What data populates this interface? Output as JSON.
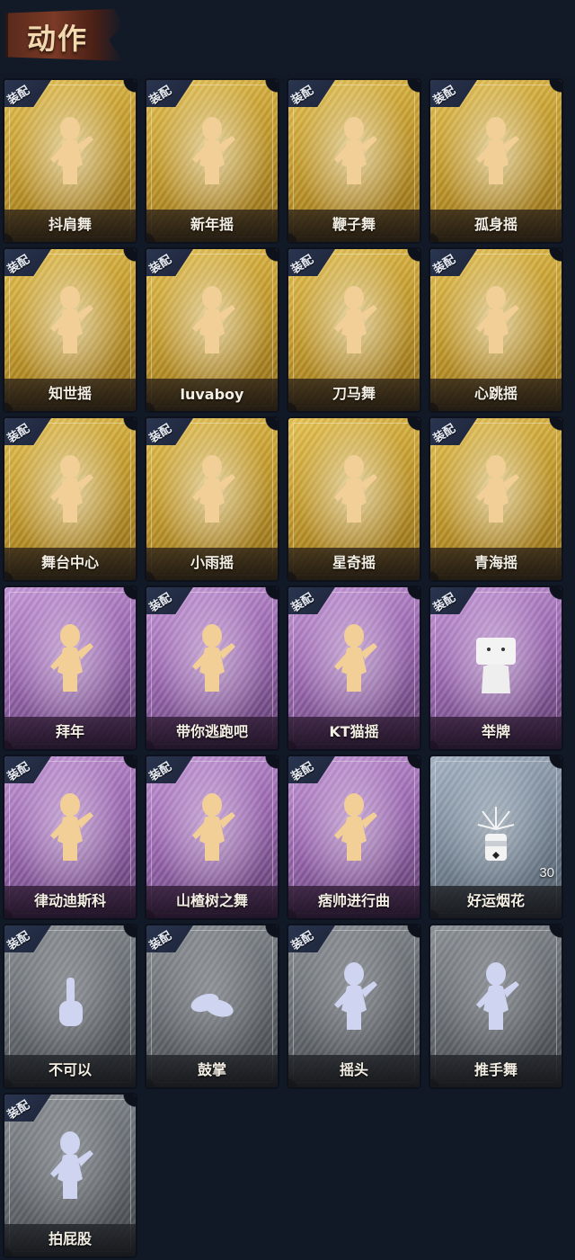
{
  "header": {
    "title": "动作"
  },
  "equip_label": "装配",
  "colors": {
    "gold": "#c39a2b",
    "purple": "#9a67b0",
    "blue": "#7c8b9b",
    "grey": "#6a6f75",
    "background": "#111826"
  },
  "cards": [
    {
      "name": "抖肩舞",
      "rarity": "gold",
      "equipped": true,
      "icon": "dancer-icon"
    },
    {
      "name": "新年摇",
      "rarity": "gold",
      "equipped": true,
      "icon": "dancer-icon"
    },
    {
      "name": "鞭子舞",
      "rarity": "gold",
      "equipped": true,
      "icon": "dancer-icon"
    },
    {
      "name": "孤身摇",
      "rarity": "gold",
      "equipped": true,
      "icon": "dancer-icon"
    },
    {
      "name": "知世摇",
      "rarity": "gold",
      "equipped": true,
      "icon": "dancer-icon"
    },
    {
      "name": "luvaboy",
      "rarity": "gold",
      "equipped": true,
      "icon": "dancer-icon"
    },
    {
      "name": "刀马舞",
      "rarity": "gold",
      "equipped": true,
      "icon": "dancer-icon"
    },
    {
      "name": "心跳摇",
      "rarity": "gold",
      "equipped": true,
      "icon": "dancer-icon"
    },
    {
      "name": "舞台中心",
      "rarity": "gold",
      "equipped": true,
      "icon": "dancer-icon"
    },
    {
      "name": "小雨摇",
      "rarity": "gold",
      "equipped": true,
      "icon": "dancer-icon"
    },
    {
      "name": "星奇摇",
      "rarity": "gold",
      "equipped": false,
      "icon": "dancer-icon"
    },
    {
      "name": "青海摇",
      "rarity": "gold",
      "equipped": true,
      "icon": "dancer-icon"
    },
    {
      "name": "拜年",
      "rarity": "purple",
      "equipped": false,
      "icon": "bow-figure-icon"
    },
    {
      "name": "带你逃跑吧",
      "rarity": "purple",
      "equipped": true,
      "icon": "dancer-icon"
    },
    {
      "name": "KT猫摇",
      "rarity": "purple",
      "equipped": true,
      "icon": "dancer-icon"
    },
    {
      "name": "举牌",
      "rarity": "purple",
      "equipped": true,
      "icon": "sign-holder-icon"
    },
    {
      "name": "律动迪斯科",
      "rarity": "purple",
      "equipped": true,
      "icon": "dancer-icon"
    },
    {
      "name": "山楂树之舞",
      "rarity": "purple",
      "equipped": true,
      "icon": "dancer-icon"
    },
    {
      "name": "痞帅进行曲",
      "rarity": "purple",
      "equipped": true,
      "icon": "dancer-icon"
    },
    {
      "name": "好运烟花",
      "rarity": "blue",
      "equipped": false,
      "icon": "firework-can-icon",
      "count": "30"
    },
    {
      "name": "不可以",
      "rarity": "grey",
      "equipped": true,
      "icon": "finger-wag-icon"
    },
    {
      "name": "鼓掌",
      "rarity": "grey",
      "equipped": true,
      "icon": "clapping-hands-icon"
    },
    {
      "name": "摇头",
      "rarity": "grey",
      "equipped": true,
      "icon": "dancer-icon"
    },
    {
      "name": "推手舞",
      "rarity": "grey",
      "equipped": false,
      "icon": "dancer-icon"
    },
    {
      "name": "拍屁股",
      "rarity": "grey",
      "equipped": true,
      "icon": "dancer-icon"
    }
  ]
}
